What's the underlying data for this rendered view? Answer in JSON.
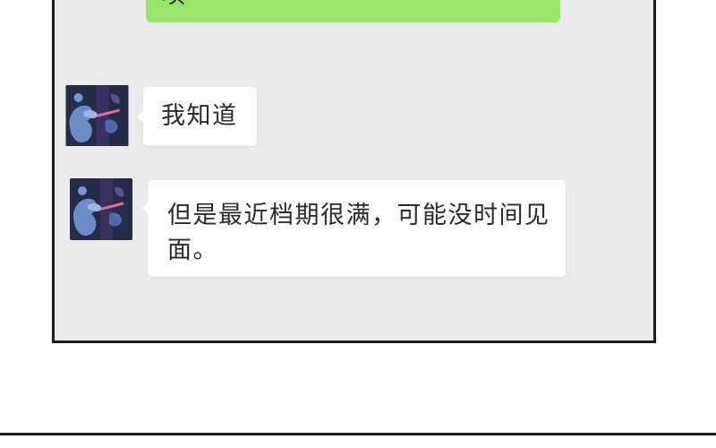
{
  "chat": {
    "sent_message": {
      "text": "呗"
    },
    "received": [
      {
        "lines": [
          "我知道"
        ]
      },
      {
        "lines": [
          "但是最近档期很满，可能没时间见",
          "面。"
        ]
      }
    ]
  },
  "icons": {
    "avatar": "contact-avatar-image"
  },
  "colors": {
    "panel_background": "#ebebeb",
    "panel_border": "#1c1c1c",
    "sent_bubble": "#98e46b",
    "received_bubble": "#ffffff",
    "text": "#2b2b2b"
  }
}
